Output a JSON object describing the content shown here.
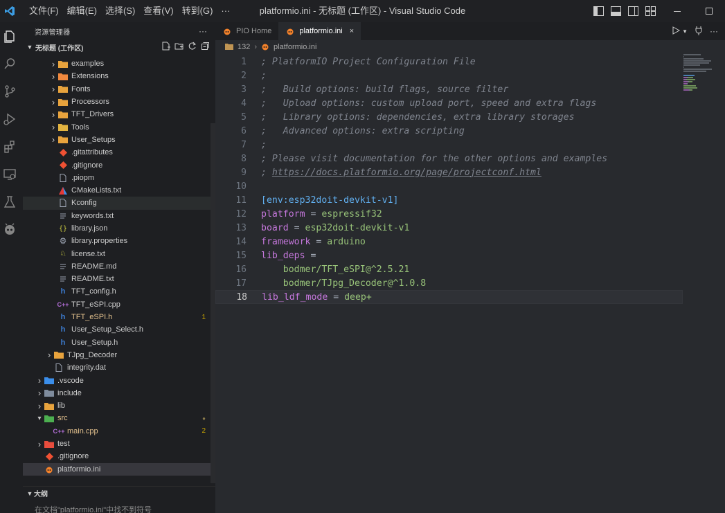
{
  "window": {
    "title": "platformio.ini - 无标题 (工作区) - Visual Studio Code",
    "menu": [
      "文件(F)",
      "编辑(E)",
      "选择(S)",
      "查看(V)",
      "转到(G)",
      "···"
    ]
  },
  "sidebar": {
    "header": "资源管理器",
    "more": "···",
    "workspace": "无标题 (工作区)",
    "tree": [
      {
        "label": "examples",
        "depth": 2,
        "kind": "folder",
        "expanded": false,
        "icon_color": "#e8a33d"
      },
      {
        "label": "Extensions",
        "depth": 2,
        "kind": "folder",
        "expanded": false,
        "icon_color": "#f0883e"
      },
      {
        "label": "Fonts",
        "depth": 2,
        "kind": "folder",
        "expanded": false,
        "icon_color": "#e8a33d"
      },
      {
        "label": "Processors",
        "depth": 2,
        "kind": "folder",
        "expanded": false,
        "icon_color": "#e8a33d"
      },
      {
        "label": "TFT_Drivers",
        "depth": 2,
        "kind": "folder",
        "expanded": false,
        "icon_color": "#e8a33d"
      },
      {
        "label": "Tools",
        "depth": 2,
        "kind": "folder",
        "expanded": false,
        "icon_color": "#e2b340"
      },
      {
        "label": "User_Setups",
        "depth": 2,
        "kind": "folder",
        "expanded": false,
        "icon_color": "#e8a33d"
      },
      {
        "label": ".gitattributes",
        "depth": 2,
        "kind": "file",
        "icon": "git",
        "icon_color": "#f05133"
      },
      {
        "label": ".gitignore",
        "depth": 2,
        "kind": "file",
        "icon": "git",
        "icon_color": "#f05133"
      },
      {
        "label": ".piopm",
        "depth": 2,
        "kind": "file",
        "icon": "file",
        "icon_color": "#9da5b4"
      },
      {
        "label": "CMakeLists.txt",
        "depth": 2,
        "kind": "file",
        "icon": "cmake",
        "icon_color": "#3b8eea"
      },
      {
        "label": "Kconfig",
        "depth": 2,
        "kind": "file",
        "icon": "file",
        "icon_color": "#9da5b4",
        "state": "focus"
      },
      {
        "label": "keywords.txt",
        "depth": 2,
        "kind": "file",
        "icon": "txt",
        "icon_color": "#9da5b4"
      },
      {
        "label": "library.json",
        "depth": 2,
        "kind": "file",
        "icon": "json",
        "icon_color": "#cbcb41"
      },
      {
        "label": "library.properties",
        "depth": 2,
        "kind": "file",
        "icon": "gear",
        "icon_color": "#9da5b4"
      },
      {
        "label": "license.txt",
        "depth": 2,
        "kind": "file",
        "icon": "license",
        "icon_color": "#cbcb41"
      },
      {
        "label": "README.md",
        "depth": 2,
        "kind": "file",
        "icon": "txt",
        "icon_color": "#9da5b4"
      },
      {
        "label": "README.txt",
        "depth": 2,
        "kind": "file",
        "icon": "txt",
        "icon_color": "#9da5b4"
      },
      {
        "label": "TFT_config.h",
        "depth": 2,
        "kind": "file",
        "icon": "h",
        "icon_color": "#3d7ed4"
      },
      {
        "label": "TFT_eSPI.cpp",
        "depth": 2,
        "kind": "file",
        "icon": "cpp",
        "icon_color": "#b16dd6"
      },
      {
        "label": "TFT_eSPI.h",
        "depth": 2,
        "kind": "file",
        "icon": "h",
        "icon_color": "#3d7ed4",
        "modified": true,
        "badge": "1"
      },
      {
        "label": "User_Setup_Select.h",
        "depth": 2,
        "kind": "file",
        "icon": "h",
        "icon_color": "#3d7ed4"
      },
      {
        "label": "User_Setup.h",
        "depth": 2,
        "kind": "file",
        "icon": "h",
        "icon_color": "#3d7ed4"
      },
      {
        "label": "TJpg_Decoder",
        "depth": 1,
        "kind": "folder",
        "expanded": false,
        "icon_color": "#e8a33d"
      },
      {
        "label": "integrity.dat",
        "depth": 1,
        "kind": "file",
        "icon": "file",
        "icon_color": "#9da5b4"
      },
      {
        "label": ".vscode",
        "depth": 0,
        "kind": "folder",
        "expanded": false,
        "icon_color": "#3b8eea"
      },
      {
        "label": "include",
        "depth": 0,
        "kind": "folder",
        "expanded": false,
        "icon_color": "#7f8c9d"
      },
      {
        "label": "lib",
        "depth": 0,
        "kind": "folder",
        "expanded": false,
        "icon_color": "#e8a33d"
      },
      {
        "label": "src",
        "depth": 0,
        "kind": "folder",
        "expanded": true,
        "icon_color": "#4caf50",
        "modified": true,
        "badge": "●"
      },
      {
        "label": "main.cpp",
        "depth": 1,
        "kind": "file",
        "icon": "cpp",
        "icon_color": "#b16dd6",
        "modified": true,
        "badge": "2"
      },
      {
        "label": "test",
        "depth": 0,
        "kind": "folder",
        "expanded": false,
        "icon_color": "#e84d3d"
      },
      {
        "label": ".gitignore",
        "depth": 0,
        "kind": "file",
        "icon": "git",
        "icon_color": "#f05133"
      },
      {
        "label": "platformio.ini",
        "depth": 0,
        "kind": "file",
        "icon": "pio",
        "icon_color": "#f5822a",
        "state": "selected"
      }
    ],
    "outline": {
      "title": "大纲",
      "message": "在文档\"platformio.ini\"中找不到符号"
    }
  },
  "editor": {
    "tabs": [
      {
        "label": "PIO Home",
        "active": false
      },
      {
        "label": "platformio.ini",
        "active": true,
        "close": "×"
      }
    ],
    "breadcrumb": [
      "132",
      "platformio.ini"
    ],
    "current_line": 18,
    "lines": [
      [
        {
          "t": "; PlatformIO Project Configuration File",
          "c": "com"
        }
      ],
      [
        {
          "t": ";",
          "c": "com"
        }
      ],
      [
        {
          "t": ";   Build options: build flags, source filter",
          "c": "com"
        }
      ],
      [
        {
          "t": ";   Upload options: custom upload port, speed and extra flags",
          "c": "com"
        }
      ],
      [
        {
          "t": ";   Library options: dependencies, extra library storages",
          "c": "com"
        }
      ],
      [
        {
          "t": ";   Advanced options: extra scripting",
          "c": "com"
        }
      ],
      [
        {
          "t": ";",
          "c": "com"
        }
      ],
      [
        {
          "t": "; Please visit documentation for the other options and examples",
          "c": "com"
        }
      ],
      [
        {
          "t": "; ",
          "c": "com"
        },
        {
          "t": "https://docs.platformio.org/page/projectconf.html",
          "c": "com url"
        }
      ],
      [],
      [
        {
          "t": "[env:esp32doit-devkit-v1]",
          "c": "sec"
        }
      ],
      [
        {
          "t": "platform",
          "c": "key"
        },
        {
          "t": " = ",
          "c": "op"
        },
        {
          "t": "espressif32",
          "c": "val"
        }
      ],
      [
        {
          "t": "board",
          "c": "key"
        },
        {
          "t": " = ",
          "c": "op"
        },
        {
          "t": "esp32doit-devkit-v1",
          "c": "val"
        }
      ],
      [
        {
          "t": "framework",
          "c": "key"
        },
        {
          "t": " = ",
          "c": "op"
        },
        {
          "t": "arduino",
          "c": "val"
        }
      ],
      [
        {
          "t": "lib_deps",
          "c": "key"
        },
        {
          "t": " =",
          "c": "op"
        }
      ],
      [
        {
          "t": "    bodmer/TFT_eSPI@^2.5.21",
          "c": "val"
        }
      ],
      [
        {
          "t": "    bodmer/TJpg_Decoder@^1.0.8",
          "c": "val"
        }
      ],
      [
        {
          "t": "lib_ldf_mode",
          "c": "key"
        },
        {
          "t": " = ",
          "c": "op"
        },
        {
          "t": "deep+",
          "c": "val"
        }
      ]
    ]
  }
}
